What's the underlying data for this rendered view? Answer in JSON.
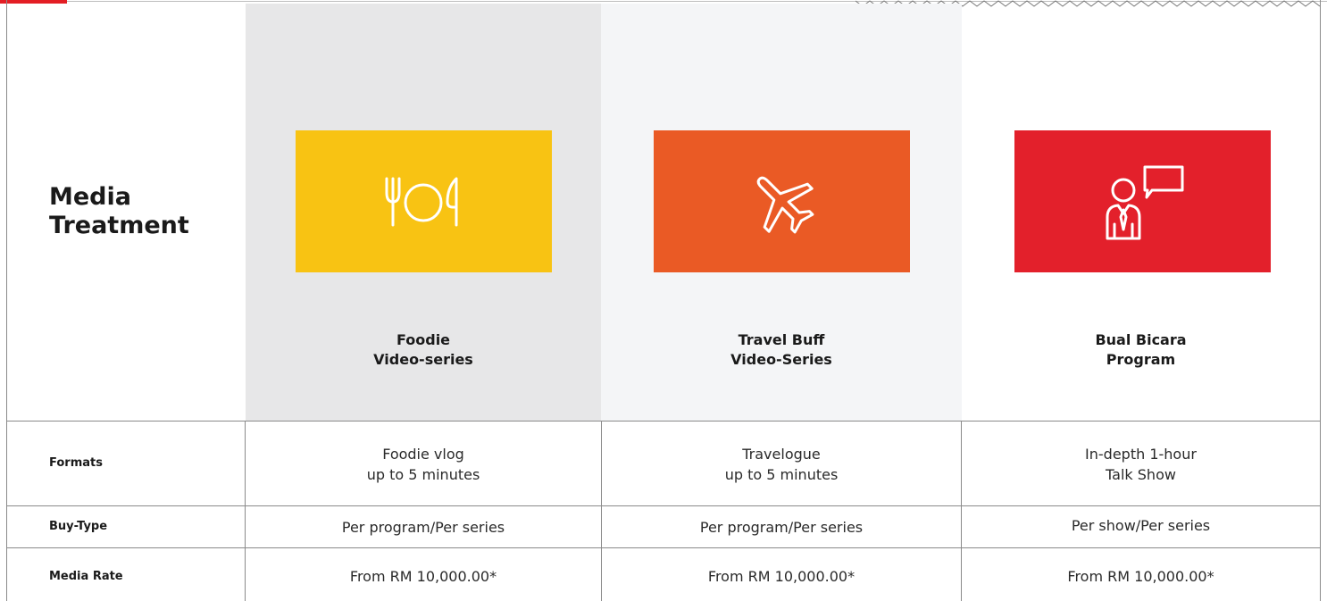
{
  "heading": "Media\nTreatment",
  "columns": [
    {
      "title": "Foodie\nVideo-series",
      "icon": "plate-fork-knife-icon",
      "color": "#f8c313"
    },
    {
      "title": "Travel Buff\nVideo-Series",
      "icon": "airplane-icon",
      "color": "#ea5a25"
    },
    {
      "title": "Bual Bicara\nProgram",
      "icon": "speaker-speech-bubble-icon",
      "color": "#e3202b"
    }
  ],
  "rows": [
    {
      "label": "Formats",
      "values": [
        "Foodie vlog\nup to 5 minutes",
        "Travelogue\nup to 5 minutes",
        "In-depth 1-hour\nTalk Show"
      ]
    },
    {
      "label": "Buy-Type",
      "values": [
        "Per program/Per series",
        "Per program/Per series",
        "Per show/Per series"
      ]
    },
    {
      "label": "Media Rate",
      "values": [
        "From RM 10,000.00*",
        "From RM 10,000.00*",
        "From RM 10,000.00*"
      ]
    }
  ],
  "colors": {
    "accent": "#e31e24",
    "line": "#8a8a8a",
    "column_shade_1": "#e7e7e8",
    "column_shade_2": "#f4f5f7"
  }
}
